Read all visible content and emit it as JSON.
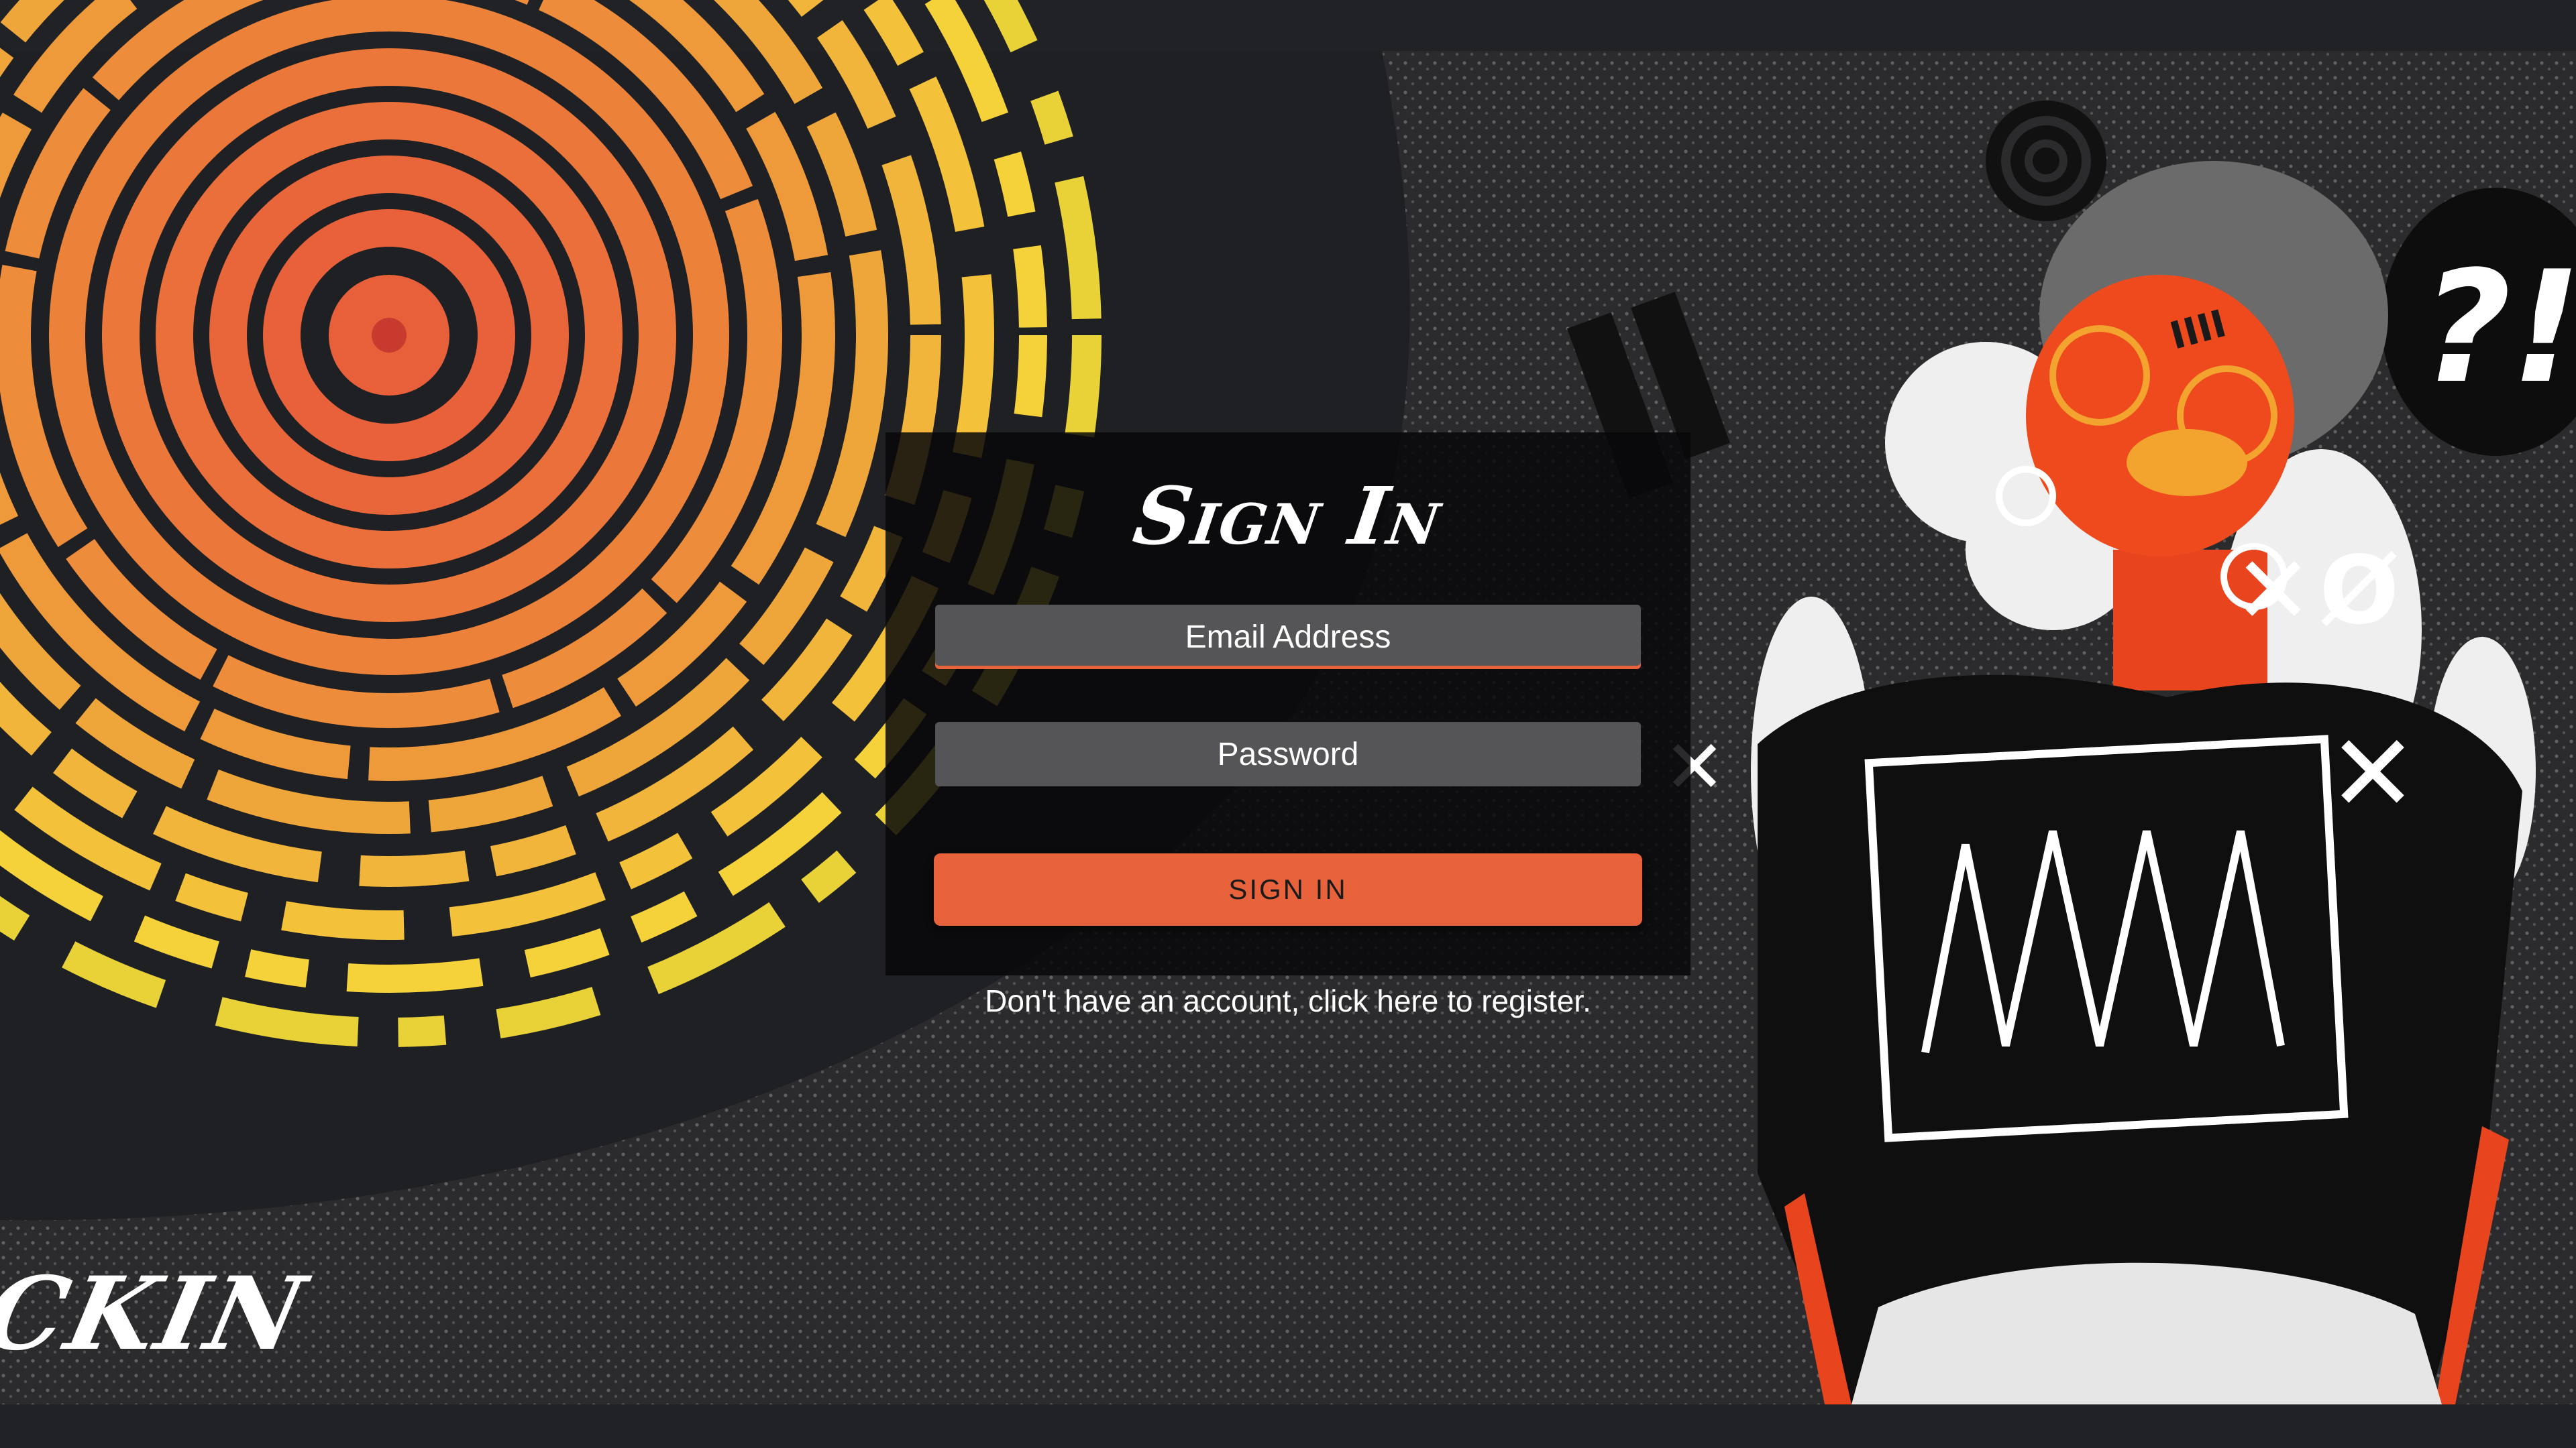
{
  "colors": {
    "background": "#1f2023",
    "accent": "#e8633c",
    "panel": "#0a0a0c",
    "field": "#555557",
    "sun_inner": "#e8603a",
    "sun_outer": "#f5e03a"
  },
  "login": {
    "title": "Sign In",
    "email_placeholder": "Email Address",
    "password_placeholder": "Password",
    "submit_label": "SIGN IN",
    "register_text": "Don't have an account, click here to register."
  },
  "branding": {
    "corner_logo": "CKIN"
  },
  "illustration": {
    "speech_bubble_text": "?!",
    "tally_mark": "IIII",
    "left_mark": "✕",
    "right_marks": [
      "✕",
      "Ø",
      "✕"
    ]
  }
}
